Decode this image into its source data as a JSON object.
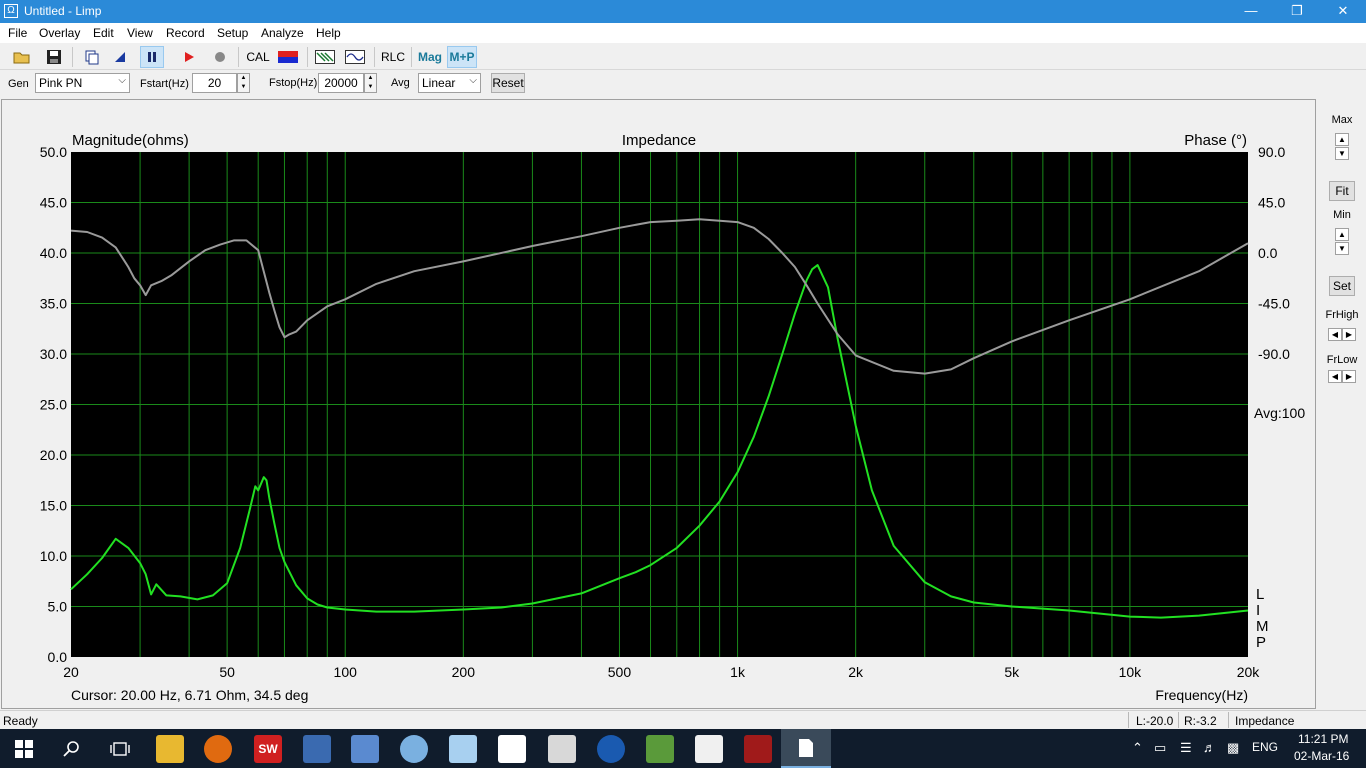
{
  "window": {
    "title": "Untitled - Limp",
    "icon": "Ω",
    "controls": [
      "—",
      "❐",
      "✕"
    ]
  },
  "menu": [
    "File",
    "Overlay",
    "Edit",
    "View",
    "Record",
    "Setup",
    "Analyze",
    "Help"
  ],
  "toolbar": {
    "icons": [
      "open-folder-icon",
      "save-icon",
      "copy-icon",
      "cursor-icon",
      "pause-icon",
      "play-icon",
      "stop-icon",
      "red-blue-bar-icon",
      "filter-icon",
      "waveform-icon"
    ],
    "cal_label": "CAL",
    "rlc_label": "RLC",
    "mag_label": "Mag",
    "mp_label": "M+P"
  },
  "gen": {
    "gen_label": "Gen",
    "gen_value": "Pink PN",
    "fstart_label": "Fstart(Hz)",
    "fstart_value": "20",
    "fstop_label": "Fstop(Hz)",
    "fstop_value": "20000",
    "avg_label": "Avg",
    "avg_value": "Linear",
    "reset_label": "Reset"
  },
  "side": {
    "max_label": "Max",
    "fit_label": "Fit",
    "min_label": "Min",
    "set_label": "Set",
    "frhigh_label": "FrHigh",
    "frlow_label": "FrLow"
  },
  "status": {
    "ready": "Ready",
    "l_value": "L:-20.0",
    "r_value": "R:-3.2",
    "mode": "Impedance Measuremen"
  },
  "taskbar": {
    "time": "11:21 PM",
    "date": "02-Mar-16",
    "lang": "ENG"
  },
  "chart_data": {
    "type": "line",
    "title": "Impedance",
    "ylabel": "Magnitude(ohms)",
    "y2label": "Phase (°)",
    "xlabel": "Frequency(Hz)",
    "xscale": "log",
    "xlim": [
      20,
      20000
    ],
    "ylim": [
      0,
      50
    ],
    "y2lim": [
      -270,
      90
    ],
    "xticks": [
      {
        "v": 20,
        "l": "20"
      },
      {
        "v": 50,
        "l": "50"
      },
      {
        "v": 100,
        "l": "100"
      },
      {
        "v": 200,
        "l": "200"
      },
      {
        "v": 500,
        "l": "500"
      },
      {
        "v": 1000,
        "l": "1k"
      },
      {
        "v": 2000,
        "l": "2k"
      },
      {
        "v": 5000,
        "l": "5k"
      },
      {
        "v": 10000,
        "l": "10k"
      },
      {
        "v": 20000,
        "l": "20k"
      }
    ],
    "yticks": [
      "0.0",
      "5.0",
      "10.0",
      "15.0",
      "20.0",
      "25.0",
      "30.0",
      "35.0",
      "40.0",
      "45.0",
      "50.0"
    ],
    "y2ticks": [
      "90.0",
      "45.0",
      "0.0",
      "-45.0",
      "-90.0"
    ],
    "avg_label": "Avg:100",
    "side_text": [
      "L",
      "I",
      "M",
      "P"
    ],
    "cursor_text": "Cursor: 20.00 Hz, 6.71 Ohm, 34.5 deg",
    "grid": true,
    "colors": {
      "background": "#000000",
      "grid": "#1a8a1a",
      "magnitude": "#22e022",
      "phase": "#9a9a9a"
    },
    "series": [
      {
        "role": "magnitude",
        "axis": "left",
        "x": [
          20,
          22,
          24,
          26,
          28,
          30,
          31,
          32,
          33,
          35,
          38,
          42,
          46,
          50,
          54,
          57,
          59,
          60,
          62,
          63,
          64,
          66,
          68,
          70,
          75,
          80,
          85,
          90,
          100,
          120,
          150,
          200,
          250,
          300,
          400,
          500,
          550,
          600,
          700,
          800,
          900,
          1000,
          1100,
          1200,
          1300,
          1400,
          1500,
          1550,
          1600,
          1700,
          1800,
          2000,
          2200,
          2500,
          3000,
          3500,
          4000,
          5000,
          7000,
          10000,
          12000,
          15000,
          20000
        ],
        "y": [
          6.7,
          8.2,
          9.8,
          11.7,
          10.8,
          9.3,
          8.2,
          6.2,
          7.2,
          6.1,
          6.0,
          5.7,
          6.1,
          7.3,
          10.8,
          14.5,
          16.9,
          16.5,
          17.8,
          17.5,
          15.8,
          13.2,
          10.8,
          9.4,
          7.1,
          5.8,
          5.2,
          4.9,
          4.7,
          4.5,
          4.5,
          4.7,
          4.9,
          5.3,
          6.3,
          7.8,
          8.4,
          9.1,
          10.8,
          13.0,
          15.4,
          18.3,
          21.8,
          25.8,
          30.0,
          34.0,
          37.3,
          38.4,
          38.8,
          36.6,
          31.5,
          22.9,
          16.5,
          11.0,
          7.4,
          6.0,
          5.4,
          5.0,
          4.6,
          4.0,
          3.9,
          4.1,
          4.6
        ]
      },
      {
        "role": "phase",
        "axis": "right",
        "x": [
          20,
          22,
          24,
          26,
          28,
          29,
          30,
          31,
          32,
          34,
          36,
          40,
          44,
          48,
          52,
          56,
          60,
          64,
          66,
          68,
          70,
          72,
          75,
          80,
          90,
          100,
          120,
          150,
          200,
          300,
          400,
          500,
          600,
          700,
          800,
          900,
          1000,
          1100,
          1200,
          1300,
          1400,
          1500,
          1600,
          1800,
          2000,
          2500,
          3000,
          3500,
          4000,
          5000,
          7000,
          10000,
          15000,
          20000
        ],
        "y": [
          34.0,
          33.0,
          29.0,
          22.0,
          8.0,
          0.0,
          -5.0,
          -12.0,
          -5.0,
          -2.0,
          2.0,
          12.0,
          20.0,
          24.0,
          27.0,
          27.0,
          20.0,
          -10.0,
          -23.0,
          -35.0,
          -42.0,
          -40.0,
          -38.0,
          -30.0,
          -20.0,
          -15.0,
          -4.0,
          5.0,
          12.0,
          23.0,
          30.0,
          36.0,
          40.0,
          41.0,
          42.0,
          41.0,
          40.0,
          36.0,
          28.0,
          18.0,
          8.0,
          -5.0,
          -18.0,
          -40.0,
          -55.0,
          -66.0,
          -68.0,
          -65.0,
          -57.0,
          -45.0,
          -30.0,
          -15.0,
          5.0,
          25.0
        ]
      }
    ]
  }
}
